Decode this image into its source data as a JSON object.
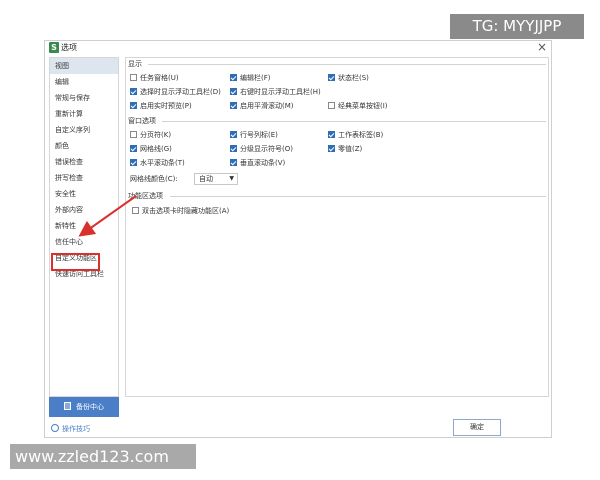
{
  "watermark": {
    "top": "TG: MYYJJPP",
    "bottom": "www.zzled123.com"
  },
  "dialog": {
    "title": "选项",
    "app_icon": "S",
    "close": "×"
  },
  "sidebar": {
    "items": [
      "视图",
      "编辑",
      "常规与保存",
      "重新计算",
      "自定义序列",
      "颜色",
      "错误检查",
      "拼写检查",
      "安全性",
      "外部内容",
      "新特性",
      "信任中心",
      "自定义功能区",
      "快速访问工具栏"
    ],
    "active_index": 0,
    "highlighted_index": 11
  },
  "display": {
    "title": "显示",
    "options": [
      {
        "label": "任务窗格(U)",
        "checked": false
      },
      {
        "label": "编辑栏(F)",
        "checked": true
      },
      {
        "label": "状态栏(S)",
        "checked": true
      },
      {
        "label": "选择时显示浮动工具栏(D)",
        "checked": true
      },
      {
        "label": "右键时显示浮动工具栏(H)",
        "checked": true
      },
      {
        "label": "启用实时预览(P)",
        "checked": true
      },
      {
        "label": "启用平滑滚动(M)",
        "checked": true
      },
      {
        "label": "经典菜单按钮(I)",
        "checked": false
      }
    ]
  },
  "window": {
    "title": "窗口选项",
    "options": [
      {
        "label": "分页符(K)",
        "checked": false
      },
      {
        "label": "行号列标(E)",
        "checked": true
      },
      {
        "label": "工作表标签(B)",
        "checked": true
      },
      {
        "label": "网格线(G)",
        "checked": true
      },
      {
        "label": "分级显示符号(O)",
        "checked": true
      },
      {
        "label": "零值(Z)",
        "checked": true
      },
      {
        "label": "水平滚动条(T)",
        "checked": true
      },
      {
        "label": "垂直滚动条(V)",
        "checked": true
      }
    ],
    "grid_color_label": "网格线颜色(C):",
    "grid_color_value": "自动"
  },
  "ribbon": {
    "title": "功能区选项",
    "options": [
      {
        "label": "双击选项卡时隐藏功能区(A)",
        "checked": false
      }
    ]
  },
  "footer": {
    "backup": "备份中心",
    "tips": "操作技巧",
    "ok": "确定"
  },
  "colors": {
    "accent": "#2f6db5",
    "highlight": "#d9302c",
    "backup_button": "#4a7fc8"
  }
}
